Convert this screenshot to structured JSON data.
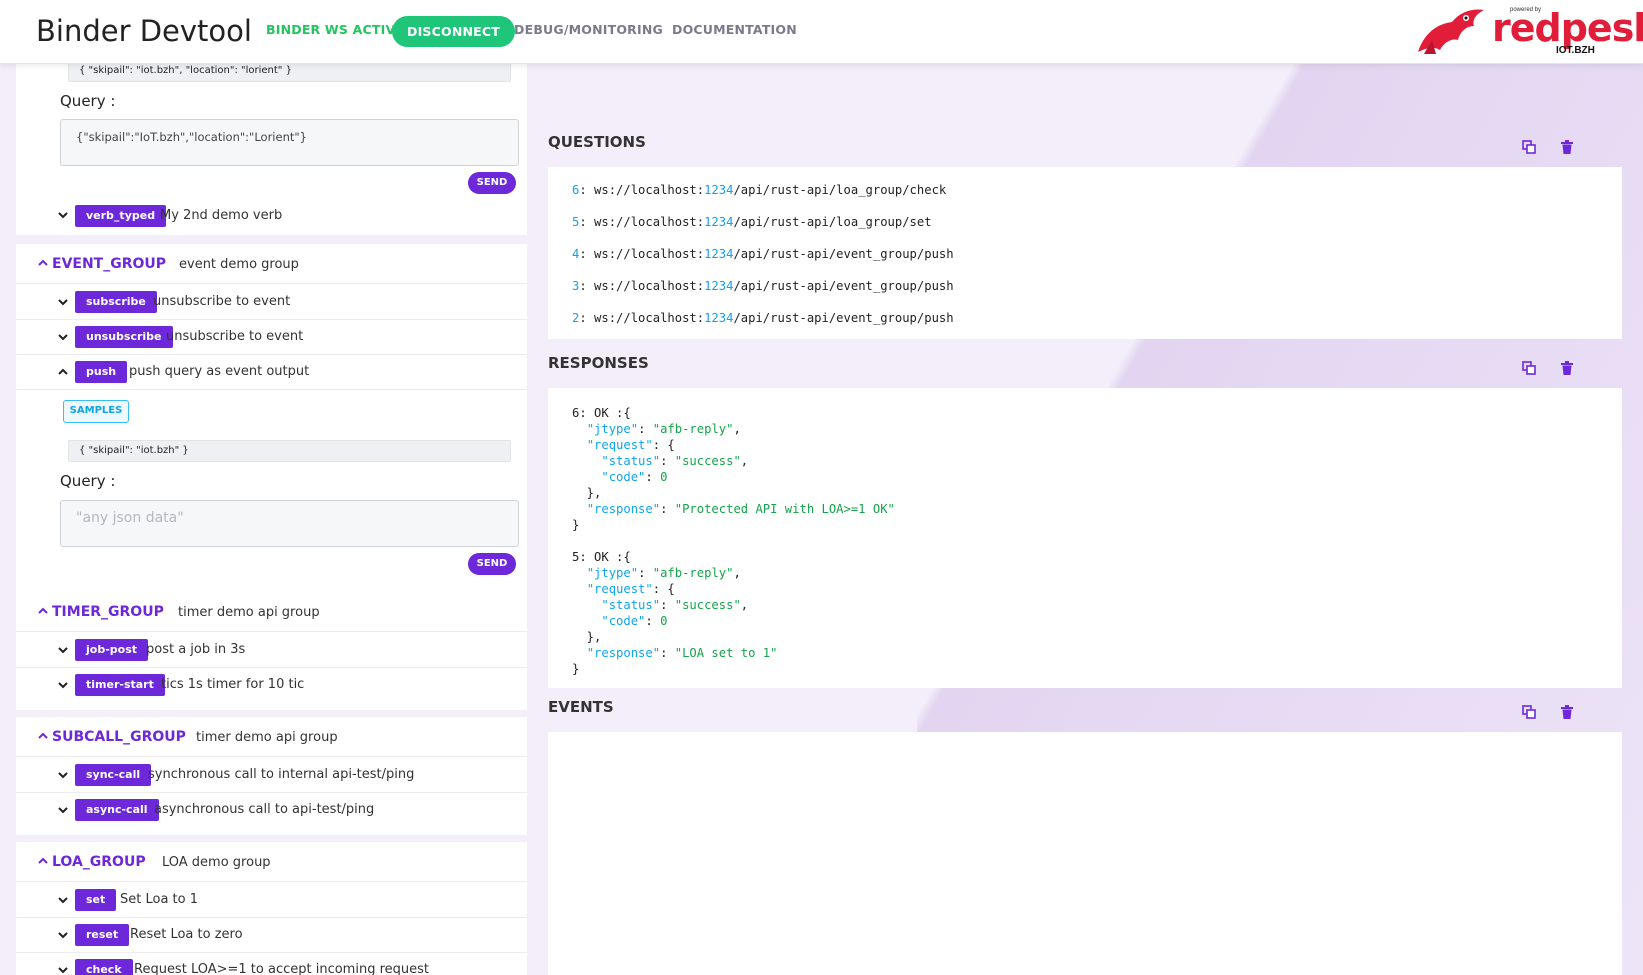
{
  "header": {
    "title": "Binder Devtool",
    "status_label": "BINDER WS ACTIVE",
    "disconnect_label": "DISCONNECT",
    "debug_label": "DEBUG/MONITORING",
    "docs_label": "DOCUMENTATION",
    "logo_text": "redpesk",
    "logo_sub": "IOT.BZH",
    "logo_powered": "powered by"
  },
  "left": {
    "top_sample": "{ \"skipail\": \"iot.bzh\", \"location\": \"lorient\" }",
    "top_query_label": "Query :",
    "top_query_value": "{\"skipail\":\"IoT.bzh\",\"location\":\"Lorient\"}",
    "send_label": "SEND",
    "verb_typed": {
      "name": "verb_typed",
      "desc": "My 2nd demo verb"
    },
    "event_group": {
      "name": "EVENT_GROUP",
      "desc": "event demo group",
      "verbs": [
        {
          "name": "subscribe",
          "desc": "unsubscribe to event"
        },
        {
          "name": "unsubscribe",
          "desc": "unsubscribe to event"
        },
        {
          "name": "push",
          "desc": "push query as event output"
        }
      ],
      "samples_label": "SAMPLES",
      "push_sample": "{ \"skipail\": \"iot.bzh\" }",
      "query_label": "Query :",
      "query_placeholder": "\"any json data\""
    },
    "timer_group": {
      "name": "TIMER_GROUP",
      "desc": "timer demo api group",
      "verbs": [
        {
          "name": "job-post",
          "desc": "post a job in 3s"
        },
        {
          "name": "timer-start",
          "desc": "tics 1s timer for 10 tic"
        }
      ]
    },
    "subcall_group": {
      "name": "SUBCALL_GROUP",
      "desc": "timer demo api group",
      "verbs": [
        {
          "name": "sync-call",
          "desc": "synchronous call to internal api-test/ping"
        },
        {
          "name": "async-call",
          "desc": "asynchronous call to api-test/ping"
        }
      ]
    },
    "loa_group": {
      "name": "LOA_GROUP",
      "desc": "LOA demo group",
      "verbs": [
        {
          "name": "set",
          "desc": "Set Loa to 1"
        },
        {
          "name": "reset",
          "desc": "Reset Loa to zero"
        },
        {
          "name": "check",
          "desc": "Request LOA>=1 to accept incoming request"
        }
      ]
    }
  },
  "right": {
    "questions_title": "QUESTIONS",
    "responses_title": "RESPONSES",
    "events_title": "EVENTS",
    "questions": [
      {
        "num": "6",
        "prefix": "ws://localhost:",
        "port": "1234",
        "path": "/api/rust-api/loa_group/check"
      },
      {
        "num": "5",
        "prefix": "ws://localhost:",
        "port": "1234",
        "path": "/api/rust-api/loa_group/set"
      },
      {
        "num": "4",
        "prefix": "ws://localhost:",
        "port": "1234",
        "path": "/api/rust-api/event_group/push"
      },
      {
        "num": "3",
        "prefix": "ws://localhost:",
        "port": "1234",
        "path": "/api/rust-api/event_group/push"
      },
      {
        "num": "2",
        "prefix": "ws://localhost:",
        "port": "1234",
        "path": "/api/rust-api/event_group/push"
      }
    ],
    "responses": [
      {
        "head": "6: OK :{",
        "jtype": "\"afb-reply\"",
        "status": "\"success\"",
        "code": "0",
        "response": "\"Protected API with LOA>=1 OK\""
      },
      {
        "head": "5: OK :{",
        "jtype": "\"afb-reply\"",
        "status": "\"success\"",
        "code": "0",
        "response": "\"LOA set to 1\""
      }
    ],
    "json_keys": {
      "jtype": "\"jtype\"",
      "request": "\"request\"",
      "status": "\"status\"",
      "code": "\"code\"",
      "response": "\"response\""
    }
  },
  "colors": {
    "accent": "#6d28d9",
    "active_green": "#22c55e",
    "disconnect_bg": "#1fc67a",
    "link_blue": "#0ea5e9",
    "string_green": "#16a34a",
    "brand_red": "#e11d3a"
  }
}
